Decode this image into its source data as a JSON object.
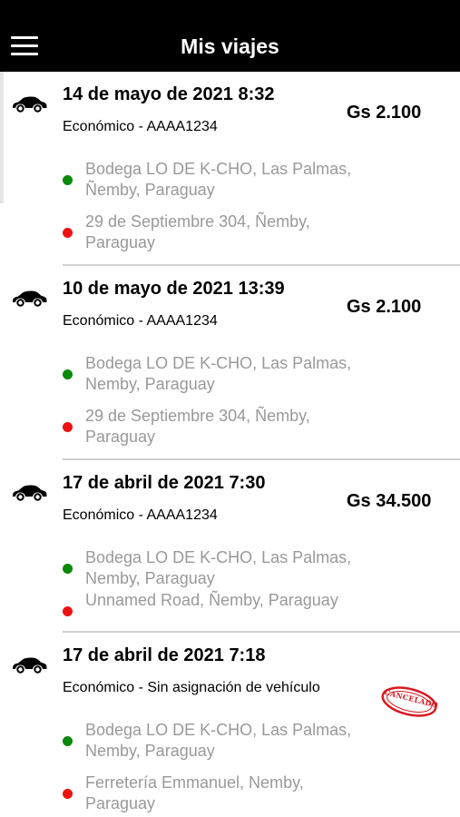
{
  "header": {
    "title": "Mis viajes",
    "menu_icon": "hamburger-menu-icon"
  },
  "colors": {
    "header_bg": "#000000",
    "origin_dot": "#0a8a0a",
    "destination_dot": "#ee1111",
    "stamp": "#d71920",
    "address_text": "#999999"
  },
  "trips": [
    {
      "datetime": "14 de mayo de 2021 8:32",
      "vehicle": "Económico - AAAA1234",
      "price": "Gs 2.100",
      "origin": "Bodega LO DE K-CHO, Las Palmas, Ñemby, Paraguay",
      "destination": "29 de Septiembre 304, Ñemby, Paraguay",
      "icon": "car-icon"
    },
    {
      "datetime": "10 de mayo de 2021 13:39",
      "vehicle": "Económico - AAAA1234",
      "price": "Gs 2.100",
      "origin": "Bodega LO DE K-CHO, Las Palmas, Nemby, Paraguay",
      "destination": "29 de Septiembre 304, Ñemby, Paraguay",
      "icon": "car-icon"
    },
    {
      "datetime": "17 de abril de 2021 7:30",
      "vehicle": "Económico - AAAA1234",
      "price": "Gs 34.500",
      "origin": "Bodega LO DE K-CHO, Las Palmas, Nemby, Paraguay",
      "destination": "Unnamed Road, Ñemby, Paraguay",
      "icon": "car-icon"
    },
    {
      "datetime": "17 de abril de 2021 7:18",
      "vehicle": "Económico - Sin asignación de vehículo",
      "price": "",
      "origin": "Bodega LO DE K-CHO, Las Palmas, Nemby, Paraguay",
      "destination": "Ferretería Emmanuel, Nemby, Paraguay",
      "status_stamp": "CANCELADO",
      "icon": "car-icon"
    }
  ]
}
